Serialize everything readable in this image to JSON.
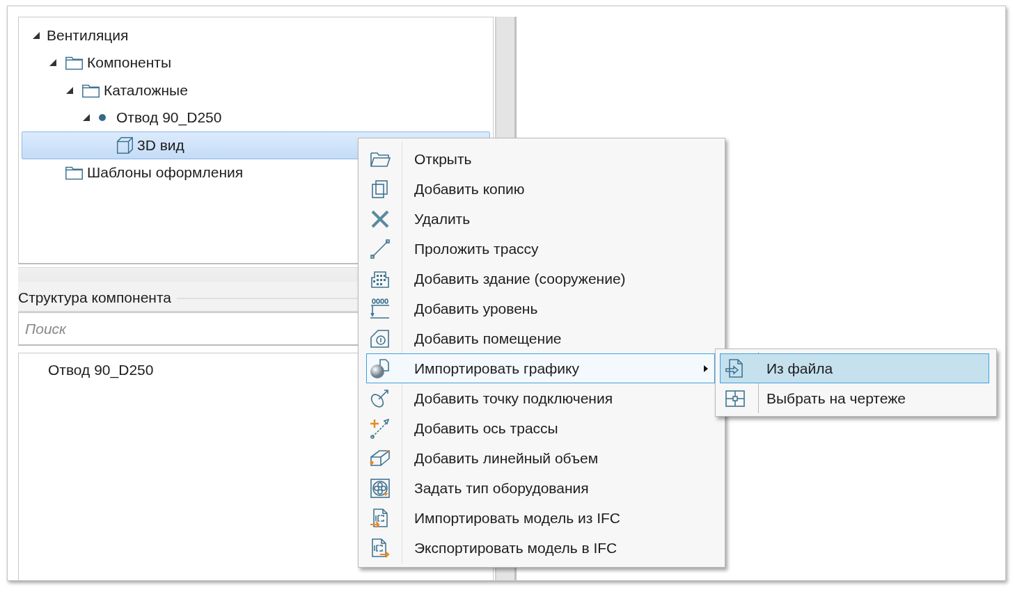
{
  "tree": [
    {
      "label": "Вентиляция",
      "expanded": true,
      "selected": false,
      "children": [
        {
          "label": "Компоненты",
          "kind": "folder",
          "expanded": true,
          "selected": false,
          "children": [
            {
              "label": "Каталожные",
              "kind": "folder",
              "expanded": true,
              "selected": false,
              "children": [
                {
                  "label": "Отвод 90_D250",
                  "kind": "element",
                  "expanded": true,
                  "selected": false,
                  "children": [
                    {
                      "label": "3D вид",
                      "kind": "view",
                      "selected": true
                    }
                  ]
                }
              ]
            }
          ]
        },
        {
          "label": "Шаблоны оформления",
          "kind": "folder",
          "selected": false
        }
      ]
    }
  ],
  "structure": {
    "title": "Структура компонента",
    "search": {
      "placeholder": "Поиск"
    },
    "items": [
      "Отвод 90_D250"
    ]
  },
  "context_menu": [
    {
      "label": "Открыть",
      "selected": false,
      "submenu": false
    },
    {
      "label": "Добавить копию",
      "selected": false,
      "submenu": false
    },
    {
      "label": "Удалить",
      "selected": false,
      "submenu": false
    },
    {
      "label": "Проложить трассу",
      "selected": false,
      "submenu": false
    },
    {
      "label": "Добавить здание (сооружение)",
      "selected": false,
      "submenu": false
    },
    {
      "label": "Добавить уровень",
      "selected": false,
      "submenu": false
    },
    {
      "label": "Добавить помещение",
      "selected": false,
      "submenu": false
    },
    {
      "label": "Импортировать графику",
      "selected": true,
      "submenu": true
    },
    {
      "label": "Добавить точку подключения",
      "selected": false,
      "submenu": false
    },
    {
      "label": "Добавить ось трассы",
      "selected": false,
      "submenu": false
    },
    {
      "label": "Добавить линейный объем",
      "selected": false,
      "submenu": false
    },
    {
      "label": "Задать тип оборудования",
      "selected": false,
      "submenu": false
    },
    {
      "label": "Импортировать модель из IFC",
      "selected": false,
      "submenu": false
    },
    {
      "label": "Экспортировать модель в IFC",
      "selected": false,
      "submenu": false
    }
  ],
  "submenu": [
    {
      "label": "Из файла",
      "selected": true
    },
    {
      "label": "Выбрать на чертеже",
      "selected": false
    }
  ]
}
